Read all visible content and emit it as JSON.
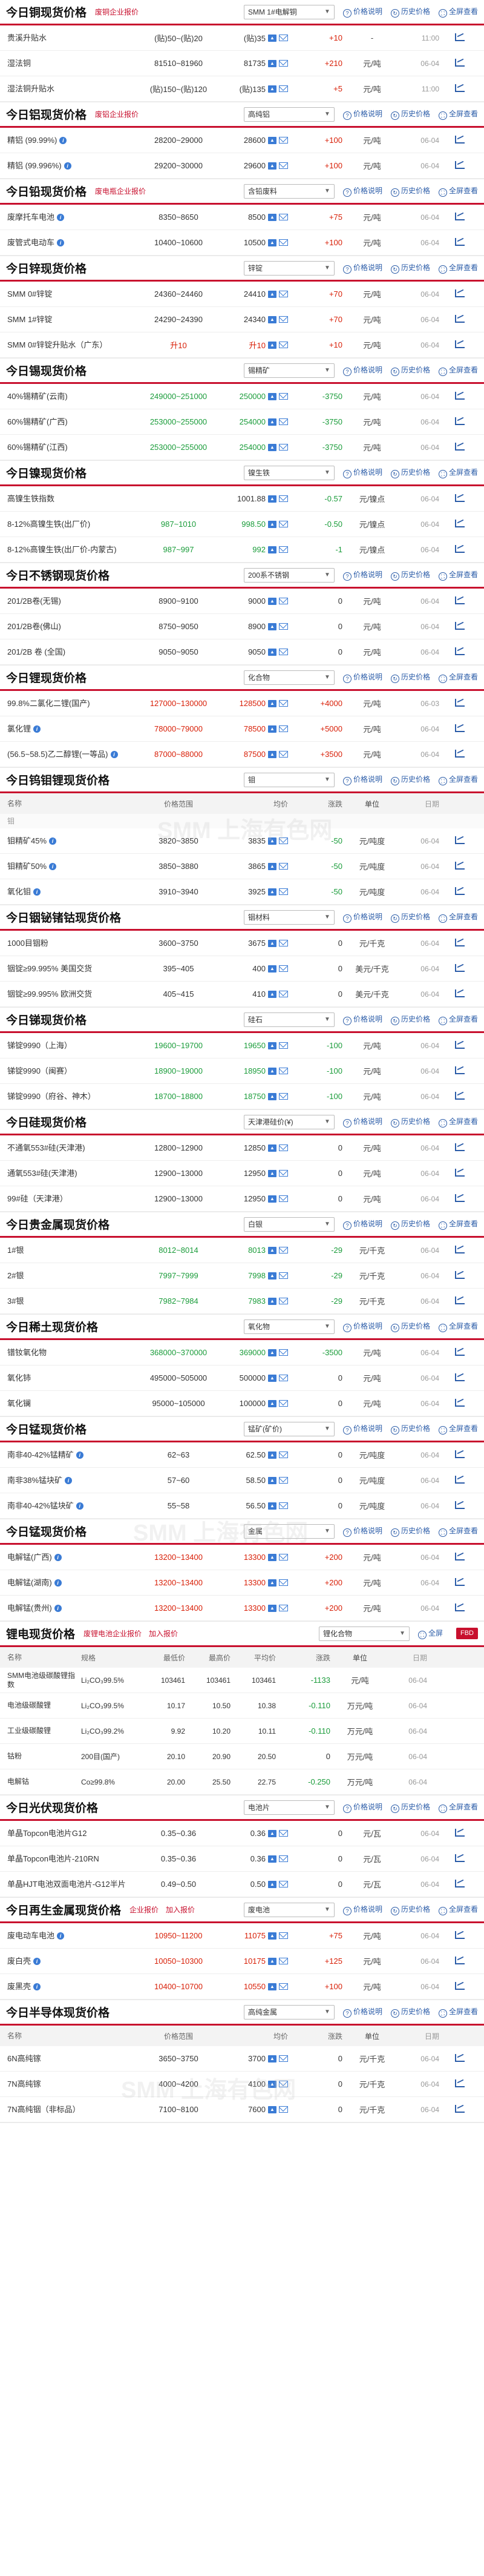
{
  "labels": {
    "price_note": "价格说明",
    "history": "历史价格",
    "full_view": "全屏查看",
    "add_quote": "加入报价"
  },
  "cols": {
    "name": "名称",
    "range": "价格范围",
    "avg": "均价",
    "chg": "涨跌",
    "unit": "单位",
    "date": "日期"
  },
  "li_cols": {
    "name": "名称",
    "spec": "规格",
    "lo": "最低价",
    "hi": "最高价",
    "mid": "平均价",
    "chg": "涨跌",
    "unit": "单位",
    "date": "日期"
  },
  "sections": [
    {
      "title": "今日铜现货价格",
      "links": [
        "废铜企业报价"
      ],
      "select": "SMM 1#电解铜",
      "rows": [
        {
          "name": "贵溪升贴水",
          "range": "(贴)50~(贴)20",
          "avg": "(贴)35",
          "chg": "+10",
          "dir": "up",
          "unit": "-",
          "date": "11:00"
        },
        {
          "name": "湿法铜",
          "range": "81510~81960",
          "avg": "81735",
          "chg": "+210",
          "dir": "up",
          "unit": "元/吨",
          "date": "06-04"
        },
        {
          "name": "湿法铜升贴水",
          "range": "(贴)150~(贴)120",
          "avg": "(贴)135",
          "chg": "+5",
          "dir": "up",
          "unit": "元/吨",
          "date": "11:00"
        }
      ]
    },
    {
      "title": "今日铝现货价格",
      "links": [
        "废铝企业报价"
      ],
      "select": "高纯铝",
      "rows": [
        {
          "name": "精铝 (99.99%)",
          "info": true,
          "range": "28200~29000",
          "avg": "28600",
          "chg": "+100",
          "dir": "up",
          "unit": "元/吨",
          "date": "06-04"
        },
        {
          "name": "精铝 (99.996%)",
          "info": true,
          "range": "29200~30000",
          "avg": "29600",
          "chg": "+100",
          "dir": "up",
          "unit": "元/吨",
          "date": "06-04"
        }
      ]
    },
    {
      "title": "今日铅现货价格",
      "links": [
        "废电瓶企业报价"
      ],
      "select": "含铅废料",
      "rows": [
        {
          "name": "废摩托车电池",
          "info": true,
          "range": "8350~8650",
          "avg": "8500",
          "chg": "+75",
          "dir": "up",
          "unit": "元/吨",
          "date": "06-04"
        },
        {
          "name": "废管式电动车",
          "info": true,
          "range": "10400~10600",
          "avg": "10500",
          "chg": "+100",
          "dir": "up",
          "unit": "元/吨",
          "date": "06-04"
        }
      ]
    },
    {
      "title": "今日锌现货价格",
      "links": [],
      "select": "锌锭",
      "rows": [
        {
          "name": "SMM 0#锌锭",
          "range": "24360~24460",
          "avg": "24410",
          "chg": "+70",
          "dir": "up",
          "unit": "元/吨",
          "date": "06-04"
        },
        {
          "name": "SMM 1#锌锭",
          "range": "24290~24390",
          "avg": "24340",
          "chg": "+70",
          "dir": "up",
          "unit": "元/吨",
          "date": "06-04"
        },
        {
          "name": "SMM 0#锌锭升贴水（广东）",
          "range": "升10",
          "avg": "升10",
          "chg": "+10",
          "dir": "up",
          "unit": "元/吨",
          "date": "06-04",
          "range_dir": "up"
        }
      ]
    },
    {
      "title": "今日锡现货价格",
      "links": [],
      "select": "锡精矿",
      "rows": [
        {
          "name": "40%锡精矿(云南)",
          "range": "249000~251000",
          "avg": "250000",
          "chg": "-3750",
          "dir": "down",
          "unit": "元/吨",
          "date": "06-04",
          "range_dir": "down"
        },
        {
          "name": "60%锡精矿(广西)",
          "range": "253000~255000",
          "avg": "254000",
          "chg": "-3750",
          "dir": "down",
          "unit": "元/吨",
          "date": "06-04",
          "range_dir": "down"
        },
        {
          "name": "60%锡精矿(江西)",
          "range": "253000~255000",
          "avg": "254000",
          "chg": "-3750",
          "dir": "down",
          "unit": "元/吨",
          "date": "06-04",
          "range_dir": "down"
        }
      ]
    },
    {
      "title": "今日镍现货价格",
      "links": [],
      "select": "镍生铁",
      "rows": [
        {
          "name": "高镍生铁指数",
          "range": "",
          "avg": "1001.88",
          "chg": "-0.57",
          "dir": "down",
          "unit": "元/镍点",
          "date": "06-04"
        },
        {
          "name": "8-12%高镍生铁(出厂价)",
          "range": "987~1010",
          "avg": "998.50",
          "chg": "-0.50",
          "dir": "down",
          "unit": "元/镍点",
          "date": "06-04",
          "range_dir": "down"
        },
        {
          "name": "8-12%高镍生铁(出厂价-内蒙古)",
          "range": "987~997",
          "avg": "992",
          "chg": "-1",
          "dir": "down",
          "unit": "元/镍点",
          "date": "06-04",
          "range_dir": "down"
        }
      ]
    },
    {
      "title": "今日不锈钢现货价格",
      "links": [],
      "select": "200系不锈钢",
      "rows": [
        {
          "name": "201/2B卷(无锡)",
          "range": "8900~9100",
          "avg": "9000",
          "chg": "0",
          "dir": "flat",
          "unit": "元/吨",
          "date": "06-04"
        },
        {
          "name": "201/2B卷(佛山)",
          "range": "8750~9050",
          "avg": "8900",
          "chg": "0",
          "dir": "flat",
          "unit": "元/吨",
          "date": "06-04"
        },
        {
          "name": "201/2B 卷 (全国)",
          "range": "9050~9050",
          "avg": "9050",
          "chg": "0",
          "dir": "flat",
          "unit": "元/吨",
          "date": "06-04"
        }
      ]
    },
    {
      "title": "今日锂现货价格",
      "links": [],
      "select": "化合物",
      "rows": [
        {
          "name": "99.8%二氯化二锂(国产)",
          "range": "127000~130000",
          "avg": "128500",
          "chg": "+4000",
          "dir": "up",
          "unit": "元/吨",
          "date": "06-03",
          "range_dir": "up"
        },
        {
          "name": "氯化锂",
          "info": true,
          "range": "78000~79000",
          "avg": "78500",
          "chg": "+5000",
          "dir": "up",
          "unit": "元/吨",
          "date": "06-04",
          "range_dir": "up"
        },
        {
          "name": "(56.5~58.5)乙二醇锂(一等品)",
          "info": true,
          "range": "87000~88000",
          "avg": "87500",
          "chg": "+3500",
          "dir": "up",
          "unit": "元/吨",
          "date": "06-04",
          "range_dir": "up"
        }
      ]
    },
    {
      "title": "今日钨钼锂现货价格",
      "links": [],
      "select": "钼",
      "colhead": true,
      "caption": "钼",
      "rows": [
        {
          "name": "钼精矿45%",
          "info": true,
          "range": "3820~3850",
          "avg": "3835",
          "chg": "-50",
          "dir": "down",
          "unit": "元/吨度",
          "date": "06-04"
        },
        {
          "name": "钼精矿50%",
          "info": true,
          "range": "3850~3880",
          "avg": "3865",
          "chg": "-50",
          "dir": "down",
          "unit": "元/吨度",
          "date": "06-04"
        },
        {
          "name": "氧化钼",
          "info": true,
          "range": "3910~3940",
          "avg": "3925",
          "chg": "-50",
          "dir": "down",
          "unit": "元/吨度",
          "date": "06-04"
        }
      ]
    },
    {
      "title": "今日铟铋锗钴现货价格",
      "links": [],
      "select": "铟材料",
      "rows": [
        {
          "name": "1000目铟粉",
          "range": "3600~3750",
          "avg": "3675",
          "chg": "0",
          "dir": "flat",
          "unit": "元/千克",
          "date": "06-04"
        },
        {
          "name": "铟锭≥99.995% 美国交货",
          "range": "395~405",
          "avg": "400",
          "chg": "0",
          "dir": "flat",
          "unit": "美元/千克",
          "date": "06-04"
        },
        {
          "name": "铟锭≥99.995% 欧洲交货",
          "range": "405~415",
          "avg": "410",
          "chg": "0",
          "dir": "flat",
          "unit": "美元/千克",
          "date": "06-04"
        }
      ]
    },
    {
      "title": "今日锑现货价格",
      "links": [],
      "select": "硅石",
      "rows": [
        {
          "name": "锑锭9990（上海）",
          "range": "19600~19700",
          "avg": "19650",
          "chg": "-100",
          "dir": "down",
          "unit": "元/吨",
          "date": "06-04",
          "range_dir": "down"
        },
        {
          "name": "锑锭9990（闽赛）",
          "range": "18900~19000",
          "avg": "18950",
          "chg": "-100",
          "dir": "down",
          "unit": "元/吨",
          "date": "06-04",
          "range_dir": "down"
        },
        {
          "name": "锑锭9990（府谷、神木）",
          "range": "18700~18800",
          "avg": "18750",
          "chg": "-100",
          "dir": "down",
          "unit": "元/吨",
          "date": "06-04",
          "range_dir": "down"
        }
      ]
    },
    {
      "title": "今日硅现货价格",
      "links": [],
      "select": "天津港硅价(¥)",
      "rows": [
        {
          "name": "不通氧553#硅(天津港)",
          "range": "12800~12900",
          "avg": "12850",
          "chg": "0",
          "dir": "flat",
          "unit": "元/吨",
          "date": "06-04"
        },
        {
          "name": "通氧553#硅(天津港)",
          "range": "12900~13000",
          "avg": "12950",
          "chg": "0",
          "dir": "flat",
          "unit": "元/吨",
          "date": "06-04"
        },
        {
          "name": "99#硅（天津港）",
          "range": "12900~13000",
          "avg": "12950",
          "chg": "0",
          "dir": "flat",
          "unit": "元/吨",
          "date": "06-04"
        }
      ]
    },
    {
      "title": "今日贵金属现货价格",
      "links": [],
      "select": "白银",
      "rows": [
        {
          "name": "1#银",
          "range": "8012~8014",
          "avg": "8013",
          "chg": "-29",
          "dir": "down",
          "unit": "元/千克",
          "date": "06-04",
          "range_dir": "down"
        },
        {
          "name": "2#银",
          "range": "7997~7999",
          "avg": "7998",
          "chg": "-29",
          "dir": "down",
          "unit": "元/千克",
          "date": "06-04",
          "range_dir": "down"
        },
        {
          "name": "3#银",
          "range": "7982~7984",
          "avg": "7983",
          "chg": "-29",
          "dir": "down",
          "unit": "元/千克",
          "date": "06-04",
          "range_dir": "down"
        }
      ]
    },
    {
      "title": "今日稀土现货价格",
      "links": [],
      "select": "氧化物",
      "rows": [
        {
          "name": "镨钕氧化物",
          "range": "368000~370000",
          "avg": "369000",
          "chg": "-3500",
          "dir": "down",
          "unit": "元/吨",
          "date": "06-04",
          "range_dir": "down"
        },
        {
          "name": "氧化铈",
          "range": "495000~505000",
          "avg": "500000",
          "chg": "0",
          "dir": "flat",
          "unit": "元/吨",
          "date": "06-04"
        },
        {
          "name": "氧化镧",
          "range": "95000~105000",
          "avg": "100000",
          "chg": "0",
          "dir": "flat",
          "unit": "元/吨",
          "date": "06-04"
        }
      ]
    },
    {
      "title": "今日锰现货价格",
      "links": [],
      "select": "锰矿(矿价)",
      "rows": [
        {
          "name": "南非40-42%锰精矿",
          "info": true,
          "range": "62~63",
          "avg": "62.50",
          "chg": "0",
          "dir": "flat",
          "unit": "元/吨度",
          "date": "06-04"
        },
        {
          "name": "南非38%锰块矿",
          "info": true,
          "range": "57~60",
          "avg": "58.50",
          "chg": "0",
          "dir": "flat",
          "unit": "元/吨度",
          "date": "06-04"
        },
        {
          "name": "南非40-42%锰块矿",
          "info": true,
          "range": "55~58",
          "avg": "56.50",
          "chg": "0",
          "dir": "flat",
          "unit": "元/吨度",
          "date": "06-04"
        }
      ]
    },
    {
      "title": "今日锰现货价格",
      "links": [],
      "select": "金属",
      "rows": [
        {
          "name": "电解锰(广西)",
          "info": true,
          "range": "13200~13400",
          "avg": "13300",
          "chg": "+200",
          "dir": "up",
          "unit": "元/吨",
          "date": "06-04",
          "range_dir": "up"
        },
        {
          "name": "电解锰(湖南)",
          "info": true,
          "range": "13200~13400",
          "avg": "13300",
          "chg": "+200",
          "dir": "up",
          "unit": "元/吨",
          "date": "06-04",
          "range_dir": "up"
        },
        {
          "name": "电解锰(贵州)",
          "info": true,
          "range": "13200~13400",
          "avg": "13300",
          "chg": "+200",
          "dir": "up",
          "unit": "元/吨",
          "date": "06-04",
          "range_dir": "up"
        }
      ]
    }
  ],
  "li_section": {
    "title": "锂电现货价格",
    "links": [
      "废锂电池企业报价",
      "加入报价"
    ],
    "select": "锂化合物",
    "full": "全屏",
    "btn": "FBD",
    "rows": [
      {
        "name": "SMM电池级碳酸锂指数",
        "spec": "Li₂CO₃99.5%",
        "lo": "103461",
        "hi": "103461",
        "mid": "103461",
        "chg": "-1133",
        "dir": "down",
        "unit": "元/吨",
        "date": "06-04"
      },
      {
        "name": "电池级碳酸锂",
        "spec": "Li₂CO₃99.5%",
        "lo": "10.17",
        "hi": "10.50",
        "mid": "10.38",
        "chg": "-0.110",
        "dir": "down",
        "unit": "万元/吨",
        "date": "06-04"
      },
      {
        "name": "工业级碳酸锂",
        "spec": "Li₂CO₃99.2%",
        "lo": "9.92",
        "hi": "10.20",
        "mid": "10.11",
        "chg": "-0.110",
        "dir": "down",
        "unit": "万元/吨",
        "date": "06-04"
      },
      {
        "name": "钴粉",
        "spec": "200目(国产)",
        "lo": "20.10",
        "hi": "20.90",
        "mid": "20.50",
        "chg": "0",
        "dir": "flat",
        "unit": "万元/吨",
        "date": "06-04"
      },
      {
        "name": "电解钴",
        "spec": "Co≥99.8%",
        "lo": "20.00",
        "hi": "25.50",
        "mid": "22.75",
        "chg": "-0.250",
        "dir": "down",
        "unit": "万元/吨",
        "date": "06-04"
      }
    ]
  },
  "sections2": [
    {
      "title": "今日光伏现货价格",
      "links": [],
      "select": "电池片",
      "rows": [
        {
          "name": "单晶Topcon电池片G12",
          "range": "0.35~0.36",
          "avg": "0.36",
          "chg": "0",
          "dir": "flat",
          "unit": "元/瓦",
          "date": "06-04"
        },
        {
          "name": "单晶Topcon电池片-210RN",
          "range": "0.35~0.36",
          "avg": "0.36",
          "chg": "0",
          "dir": "flat",
          "unit": "元/瓦",
          "date": "06-04"
        },
        {
          "name": "单晶HJT电池双面电池片-G12半片",
          "range": "0.49~0.50",
          "avg": "0.50",
          "chg": "0",
          "dir": "flat",
          "unit": "元/瓦",
          "date": "06-04"
        }
      ]
    },
    {
      "title": "今日再生金属现货价格",
      "links": [
        "企业报价",
        "加入报价"
      ],
      "select": "废电池",
      "rows": [
        {
          "name": "废电动车电池",
          "info": true,
          "range": "10950~11200",
          "avg": "11075",
          "chg": "+75",
          "dir": "up",
          "unit": "元/吨",
          "date": "06-04",
          "range_dir": "up"
        },
        {
          "name": "废白壳",
          "info": true,
          "range": "10050~10300",
          "avg": "10175",
          "chg": "+125",
          "dir": "up",
          "unit": "元/吨",
          "date": "06-04",
          "range_dir": "up"
        },
        {
          "name": "废黑壳",
          "info": true,
          "range": "10400~10700",
          "avg": "10550",
          "chg": "+100",
          "dir": "up",
          "unit": "元/吨",
          "date": "06-04",
          "range_dir": "up"
        }
      ]
    },
    {
      "title": "今日半导体现货价格",
      "links": [],
      "select": "高纯金属",
      "colhead": true,
      "rows": [
        {
          "name": "6N高纯镓",
          "range": "3650~3750",
          "avg": "3700",
          "chg": "0",
          "dir": "flat",
          "unit": "元/千克",
          "date": "06-04"
        },
        {
          "name": "7N高纯镓",
          "range": "4000~4200",
          "avg": "4100",
          "chg": "0",
          "dir": "flat",
          "unit": "元/千克",
          "date": "06-04"
        },
        {
          "name": "7N高纯铟（非标品）",
          "range": "7100~8100",
          "avg": "7600",
          "chg": "0",
          "dir": "flat",
          "unit": "元/千克",
          "date": "06-04"
        }
      ]
    }
  ],
  "watermark": "SMM 上海有色网"
}
